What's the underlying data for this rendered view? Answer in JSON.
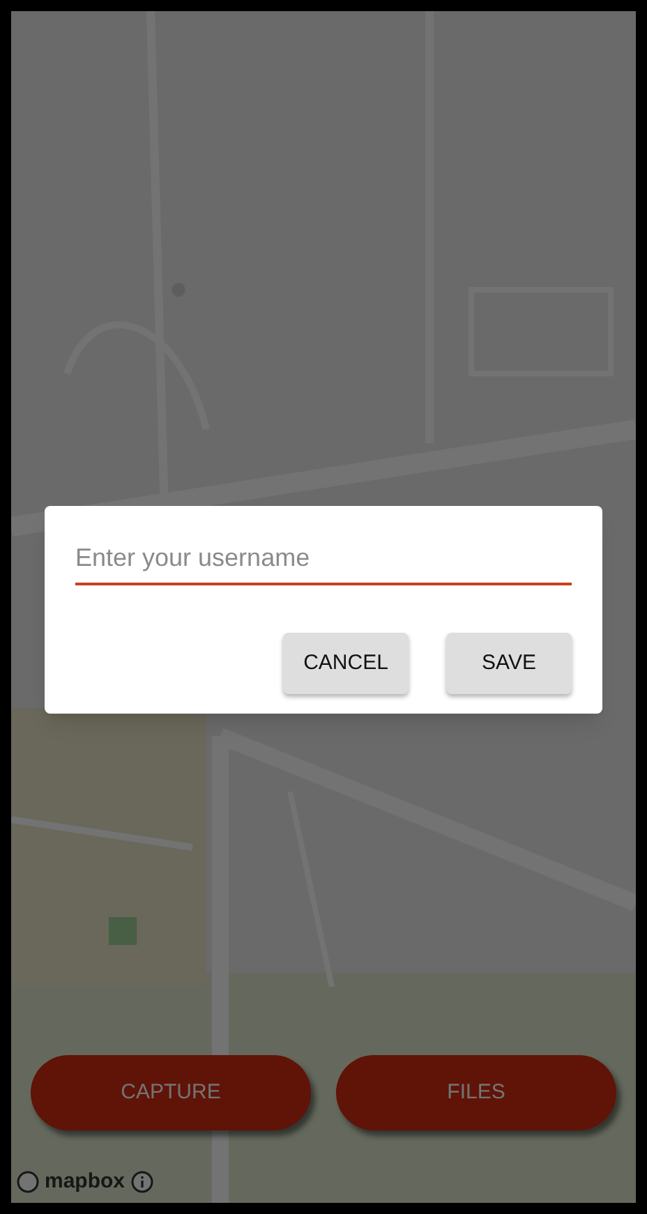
{
  "dialog": {
    "username_field": {
      "placeholder": "Enter your username"
    },
    "buttons": [
      "CANCEL",
      "SAVE"
    ]
  },
  "bottom_buttons": [
    "CAPTURE",
    "FILES"
  ],
  "attribution": {
    "logo": "mapbox"
  }
}
